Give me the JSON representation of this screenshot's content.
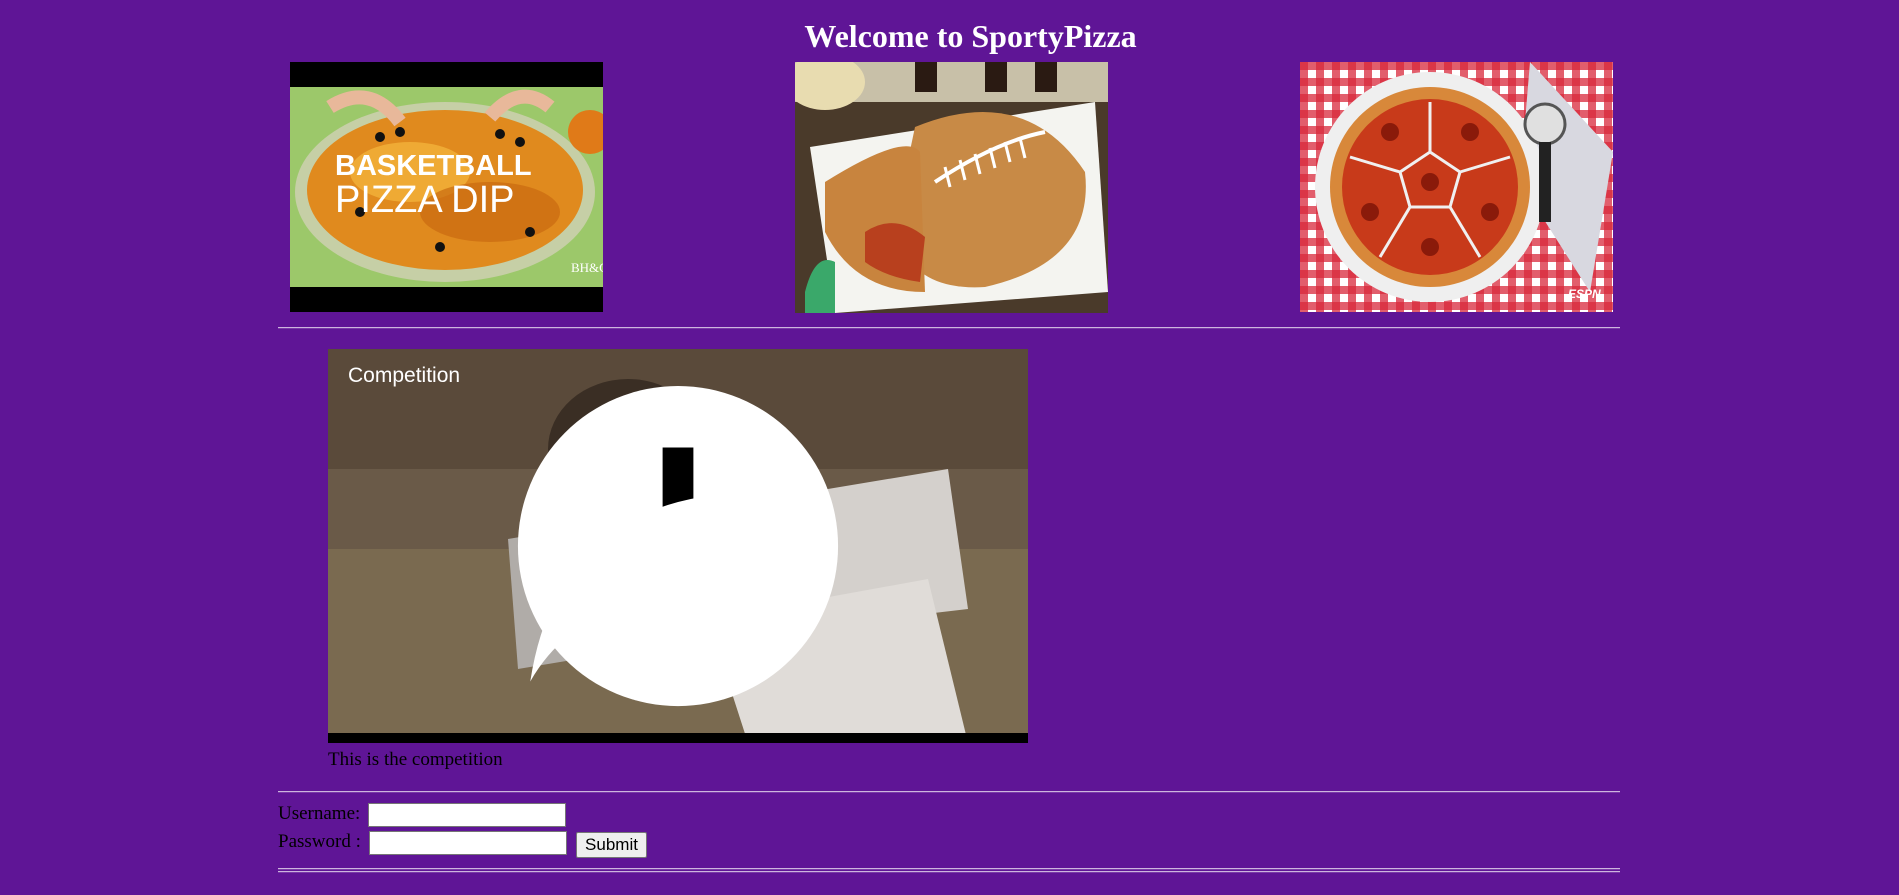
{
  "header": {
    "title": "Welcome to SportyPizza"
  },
  "thumbnails": [
    {
      "alt": "BASKETBALL PIZZA DIP",
      "line1": "BASKETBALL",
      "line2": "PIZZA DIP",
      "brand": "BH&G"
    },
    {
      "alt": "football pizza"
    },
    {
      "alt": "soccer ball pizza",
      "brand": "ESPN"
    }
  ],
  "video": {
    "title": "Competition",
    "caption": "This is the competition"
  },
  "login": {
    "username_label": "Username:",
    "password_label": "Password :",
    "username_value": "",
    "password_value": "",
    "submit_label": "Submit"
  },
  "colors": {
    "background": "#5f1596",
    "title": "#ffffff",
    "rule": "#cdb6de"
  }
}
